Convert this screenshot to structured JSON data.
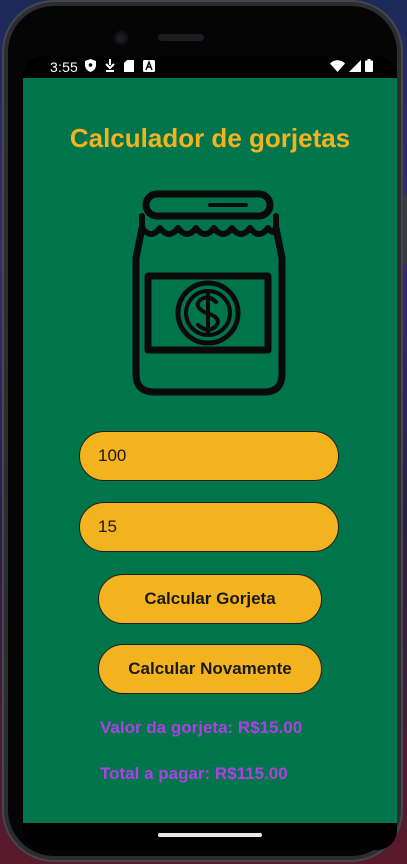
{
  "status_bar": {
    "time": "3:55",
    "left_icons": [
      "shield-icon",
      "download-icon",
      "sd-card-icon",
      "font-icon"
    ],
    "right_icons": [
      "wifi-icon",
      "signal-icon",
      "battery-icon"
    ]
  },
  "app": {
    "title": "Calculador de gorjetas",
    "illustration": "money-jar-icon",
    "bill_input": {
      "value": "100"
    },
    "percent_input": {
      "value": "15"
    },
    "buttons": {
      "calculate": "Calcular Gorjeta",
      "recalculate": "Calcular Novamente"
    },
    "results": {
      "tip": "Valor da gorjeta: R$15.00",
      "total": "Total a pagar: R$115.00"
    }
  },
  "colors": {
    "background": "#00754b",
    "accent": "#f2b31f",
    "result_text": "#b040e6"
  }
}
